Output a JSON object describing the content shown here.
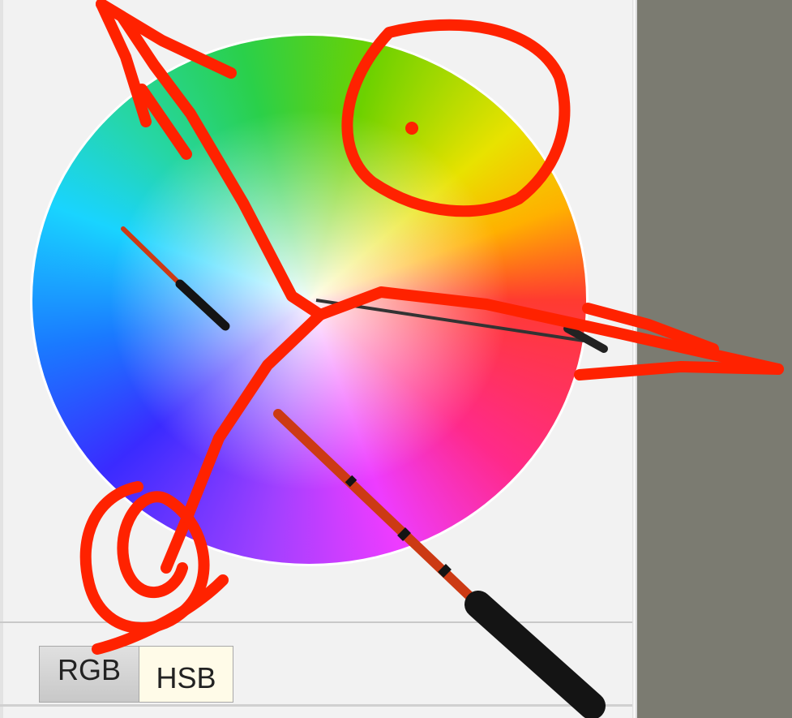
{
  "color_picker": {
    "tabs": [
      {
        "label": "RGB",
        "selected": false
      },
      {
        "label": "HSB",
        "selected": true
      }
    ],
    "wheel": {
      "type": "hue-saturation wheel"
    }
  },
  "colors": {
    "annotation": "#ff2200",
    "panel_bg": "#f2f2f2",
    "side_bg": "#7b7b71",
    "stick_shaft": "#cc3a14",
    "stick_handle": "#141414"
  },
  "icons": [
    "pointer-stick-icon",
    "pointer-stick-icon",
    "annotation-drawing-icon"
  ]
}
